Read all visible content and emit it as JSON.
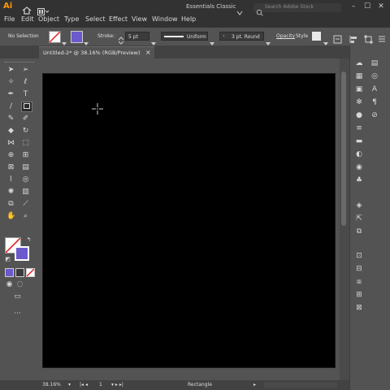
{
  "app": {
    "logo": "Ai",
    "workspace": "Essentials Classic",
    "search_placeholder": "Search Adobe Stock"
  },
  "menu": [
    "File",
    "Edit",
    "Object",
    "Type",
    "Select",
    "Effect",
    "View",
    "Window",
    "Help"
  ],
  "control_bar": {
    "selection_label": "No Selection",
    "stroke_label": "Stroke:",
    "stroke_weight": "5 pt",
    "brush": "Uniform",
    "profile": "3 pt. Round",
    "opacity_label": "Opacity",
    "style_label": "Style"
  },
  "document_tab": {
    "title": "Untitled-2* @ 38.16% (RGB/Preview)",
    "close": "×"
  },
  "status_bar": {
    "zoom": "38.16%",
    "artboard_number": "1",
    "tool_name": "Rectangle"
  },
  "colors": {
    "menubar": "#323232",
    "panel": "#535353",
    "artboard": "#000000",
    "stroke_swatch": "#6a5acd",
    "brand": "#ff9a00"
  }
}
